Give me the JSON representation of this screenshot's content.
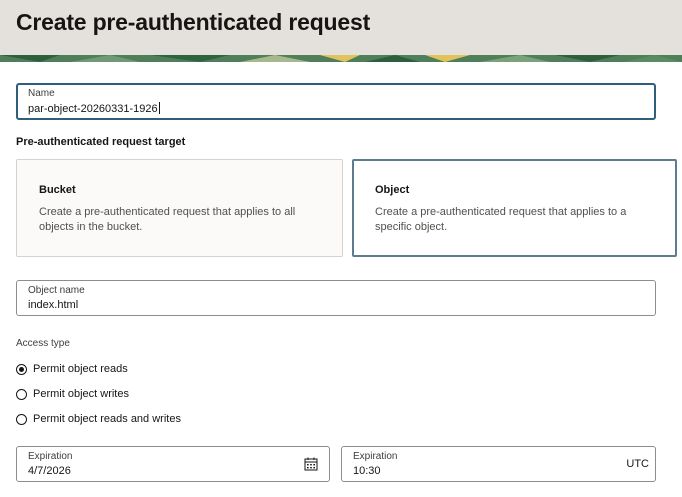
{
  "page": {
    "title": "Create pre-authenticated request"
  },
  "name_field": {
    "label": "Name",
    "value": "par-object-20260331-1926"
  },
  "target": {
    "title": "Pre-authenticated request target",
    "options": [
      {
        "title": "Bucket",
        "description": "Create a pre-authenticated request that applies to all objects in the bucket.",
        "selected": false
      },
      {
        "title": "Object",
        "description": "Create a pre-authenticated request that applies to a specific object.",
        "selected": true
      }
    ]
  },
  "object_name": {
    "label": "Object name",
    "value": "index.html"
  },
  "access_type": {
    "label": "Access type",
    "options": [
      {
        "label": "Permit object reads",
        "checked": true
      },
      {
        "label": "Permit object writes",
        "checked": false
      },
      {
        "label": "Permit object reads and writes",
        "checked": false
      }
    ]
  },
  "expiration_date": {
    "label": "Expiration",
    "value": "4/7/2026",
    "icon": "calendar-icon"
  },
  "expiration_time": {
    "label": "Expiration",
    "value": "10:30",
    "suffix": "UTC"
  },
  "colors": {
    "header_bg": "#e4e1dd",
    "focus_border": "#2f5f7d",
    "selected_card_border": "#5c7c91",
    "banner_green": "#3d7a4d",
    "banner_yellow": "#e2c25b"
  }
}
